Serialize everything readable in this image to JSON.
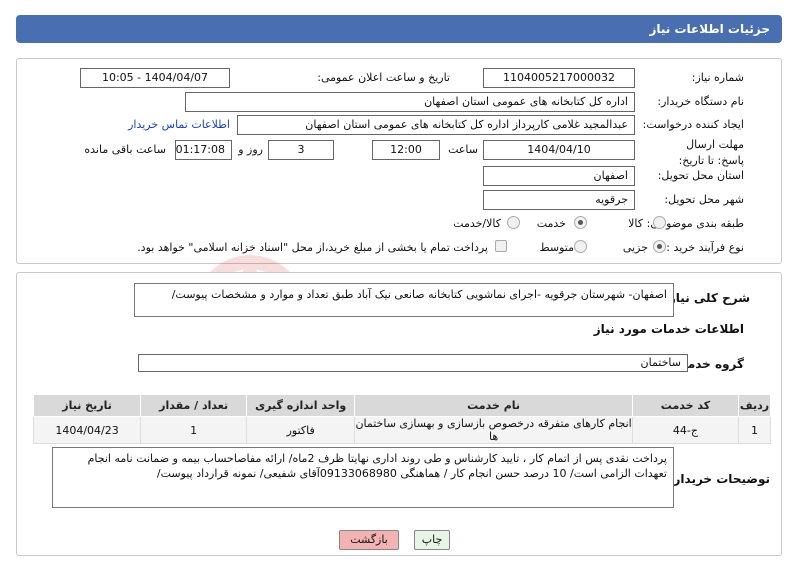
{
  "header": {
    "title": "جزئیات اطلاعات نیاز"
  },
  "form": {
    "need_number_label": "شماره نیاز:",
    "need_number": "1104005217000032",
    "announce_label": "تاریخ و ساعت اعلان عمومی:",
    "announce_value": "1404/04/07 - 10:05",
    "buyer_org_label": "نام دستگاه خریدار:",
    "buyer_org": "اداره کل کتابخانه های عمومی استان اصفهان",
    "requester_label": "ایجاد کننده درخواست:",
    "requester": "عبدالمجید غلامی کارپرداز اداره کل کتابخانه های عمومی استان اصفهان",
    "contact_link": "اطلاعات تماس خریدار",
    "deadline_label": "مهلت ارسال پاسخ: تا تاریخ:",
    "deadline_date": "1404/04/10",
    "time_label": "ساعت",
    "deadline_time": "12:00",
    "days_value": "3",
    "days_label": "روز و",
    "remaining_time": "01:17:08",
    "remaining_label": "ساعت باقی مانده",
    "province_label": "استان محل تحویل:",
    "province": "اصفهان",
    "city_label": "شهر محل تحویل:",
    "city": "جرقویه",
    "category_label": "طبقه بندی موضوعی:",
    "category_options": [
      "کالا",
      "خدمت",
      "کالا/خدمت"
    ],
    "category_selected": "خدمت",
    "process_label": "نوع فرآیند خرید :",
    "process_options": [
      "جزیی",
      "متوسط"
    ],
    "process_selected": "جزیی",
    "treasury_text": "پرداخت تمام یا بخشی از مبلغ خرید،از محل \"اسناد خزانه اسلامی\" خواهد بود."
  },
  "description": {
    "label": "شرح کلی نیاز:",
    "text": "اصفهان- شهرستان جرقویه -اجرای نماشویی کتابخانه صانعی نیک آباد طبق تعداد و موارد و مشخصات پیوست/"
  },
  "services": {
    "section_title": "اطلاعات خدمات مورد نیاز",
    "group_label": "گروه خدمت:",
    "group_value": "ساختمان",
    "columns": [
      "ردیف",
      "کد خدمت",
      "نام خدمت",
      "واحد اندازه گیری",
      "تعداد / مقدار",
      "تاریخ نیاز"
    ],
    "rows": [
      [
        "1",
        "ج-44",
        "انجام کارهای متفرقه درخصوص بازسازی و بهسازی ساختمان ها",
        "فاکتور",
        "1",
        "1404/04/23"
      ]
    ]
  },
  "buyer_notes": {
    "label": "توضیحات خریدار:",
    "text": "پرداخت نقدی پس از اتمام کار ، تایید کارشناس و طی روند اداری نهایتا ظرف 2ماه/ ارائه مفاصاحساب بیمه و ضمانت نامه انجام تعهدات الزامی است/ 10 درصد حسن انجام کار /  هماهنگی 09133068980آقای شفیعی/ نمونه قرارداد پیوست/"
  },
  "buttons": {
    "print": "چاپ",
    "back": "بازگشت"
  },
  "watermark": {
    "text": "AriaTender.neT"
  },
  "colors": {
    "header": "#4a6fb0",
    "back_button": "#f3b3b3",
    "print_button": "#e6f5e6",
    "link": "#1a44b5"
  }
}
